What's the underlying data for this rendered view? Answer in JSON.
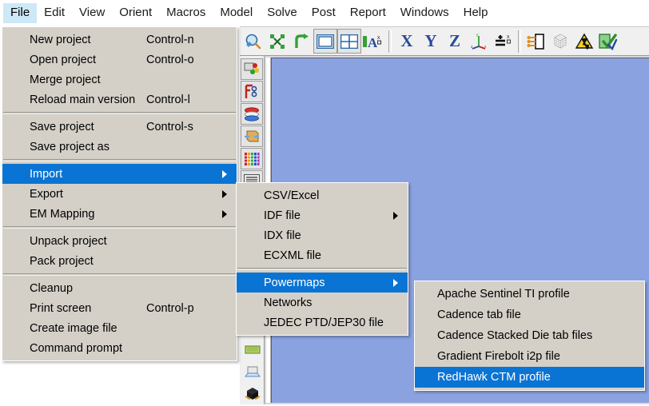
{
  "window": {
    "canvas_background_color": "#8aa2e0",
    "menu_background_color": "#d4d0c8",
    "highlight_color": "#0a74d4",
    "menubar_open_color": "#cde8f6"
  },
  "menubar": {
    "items": [
      {
        "label": "File",
        "open": true
      },
      {
        "label": "Edit",
        "open": false
      },
      {
        "label": "View",
        "open": false
      },
      {
        "label": "Orient",
        "open": false
      },
      {
        "label": "Macros",
        "open": false
      },
      {
        "label": "Model",
        "open": false
      },
      {
        "label": "Solve",
        "open": false
      },
      {
        "label": "Post",
        "open": false
      },
      {
        "label": "Report",
        "open": false
      },
      {
        "label": "Windows",
        "open": false
      },
      {
        "label": "Help",
        "open": false
      }
    ]
  },
  "toolbar_top": {
    "buttons": [
      {
        "name": "zoom-icon",
        "label": "Zoom"
      },
      {
        "name": "fit-to-window-icon",
        "label": "Fit to window"
      },
      {
        "name": "rotate-icon",
        "label": "Rotate"
      },
      {
        "name": "single-view-icon",
        "label": "Single view"
      },
      {
        "name": "quad-view-icon",
        "label": "Quad view"
      },
      {
        "name": "annotate-text-icon",
        "label": "Annotate text"
      },
      {
        "name": "axis-x-icon",
        "label": "X"
      },
      {
        "name": "axis-y-icon",
        "label": "Y"
      },
      {
        "name": "axis-z-icon",
        "label": "Z"
      },
      {
        "name": "isometric-axes-icon",
        "label": "Isometric view"
      },
      {
        "name": "scale-icon",
        "label": "Scale"
      },
      {
        "name": "boundary-condition-icon",
        "label": "Boundary condition"
      },
      {
        "name": "mesh-cube-icon",
        "label": "Mesh"
      },
      {
        "name": "warning-icon",
        "label": "Warnings"
      },
      {
        "name": "check-icon",
        "label": "Check model"
      }
    ]
  },
  "toolbar_left": {
    "buttons": [
      {
        "name": "materials-icon",
        "label": "Materials"
      },
      {
        "name": "flow-network-icon",
        "label": "Flow network"
      },
      {
        "name": "layers-icon",
        "label": "Layers"
      },
      {
        "name": "heatsink-icon",
        "label": "Heat sink"
      },
      {
        "name": "color-legend-icon",
        "label": "Color legend"
      },
      {
        "name": "list-view-icon",
        "label": "List view"
      },
      {
        "name": "board-icon",
        "label": "Board"
      },
      {
        "name": "package-icon",
        "label": "Package"
      },
      {
        "name": "die-icon",
        "label": "Die"
      }
    ]
  },
  "menu_file": {
    "name": "File",
    "items": [
      {
        "label": "New project",
        "accel": "Control-n",
        "type": "item"
      },
      {
        "label": "Open project",
        "accel": "Control-o",
        "type": "item"
      },
      {
        "label": "Merge project",
        "accel": "",
        "type": "item"
      },
      {
        "label": "Reload main version",
        "accel": "Control-l",
        "type": "item"
      },
      {
        "type": "separator"
      },
      {
        "label": "Save project",
        "accel": "Control-s",
        "type": "item"
      },
      {
        "label": "Save project as",
        "accel": "",
        "type": "item"
      },
      {
        "type": "separator"
      },
      {
        "label": "Import",
        "accel": "",
        "type": "submenu",
        "highlighted": true
      },
      {
        "label": "Export",
        "accel": "",
        "type": "submenu"
      },
      {
        "label": "EM Mapping",
        "accel": "",
        "type": "submenu"
      },
      {
        "type": "separator"
      },
      {
        "label": "Unpack project",
        "accel": "",
        "type": "item"
      },
      {
        "label": "Pack project",
        "accel": "",
        "type": "item"
      },
      {
        "type": "separator"
      },
      {
        "label": "Cleanup",
        "accel": "",
        "type": "item"
      },
      {
        "label": "Print screen",
        "accel": "Control-p",
        "type": "item"
      },
      {
        "label": "Create image file",
        "accel": "",
        "type": "item"
      },
      {
        "label": "Command prompt",
        "accel": "",
        "type": "item"
      }
    ]
  },
  "menu_import": {
    "name": "Import",
    "items": [
      {
        "label": "CSV/Excel",
        "type": "item"
      },
      {
        "label": "IDF file",
        "type": "submenu"
      },
      {
        "label": "IDX file",
        "type": "item"
      },
      {
        "label": "ECXML file",
        "type": "item"
      },
      {
        "type": "separator"
      },
      {
        "label": "Powermaps",
        "type": "submenu",
        "highlighted": true
      },
      {
        "label": "Networks",
        "type": "item"
      },
      {
        "label": "JEDEC PTD/JEP30 file",
        "type": "item"
      }
    ]
  },
  "menu_powermaps": {
    "name": "Powermaps",
    "items": [
      {
        "label": "Apache Sentinel TI profile",
        "type": "item"
      },
      {
        "label": "Cadence tab file",
        "type": "item"
      },
      {
        "label": "Cadence Stacked Die tab files",
        "type": "item"
      },
      {
        "label": "Gradient Firebolt i2p file",
        "type": "item"
      },
      {
        "label": "RedHawk CTM profile",
        "type": "item",
        "highlighted": true
      }
    ]
  }
}
